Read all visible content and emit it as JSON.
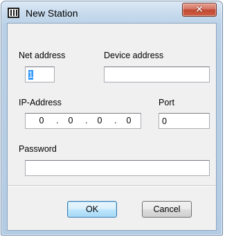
{
  "window": {
    "title": "New Station",
    "title_icon": "window-app-icon",
    "close_glyph": "✕"
  },
  "form": {
    "net_address": {
      "label": "Net address",
      "value": "1"
    },
    "device_address": {
      "label": "Device address",
      "value": ""
    },
    "ip_address": {
      "label": "IP-Address",
      "octets": [
        "0",
        "0",
        "0",
        "0"
      ],
      "separator": "."
    },
    "port": {
      "label": "Port",
      "value": "0"
    },
    "password": {
      "label": "Password",
      "value": ""
    }
  },
  "buttons": {
    "ok": "OK",
    "cancel": "Cancel"
  },
  "colors": {
    "selection": "#3399ff",
    "close_button": "#c14a32",
    "default_button_border": "#3c7fb1"
  }
}
